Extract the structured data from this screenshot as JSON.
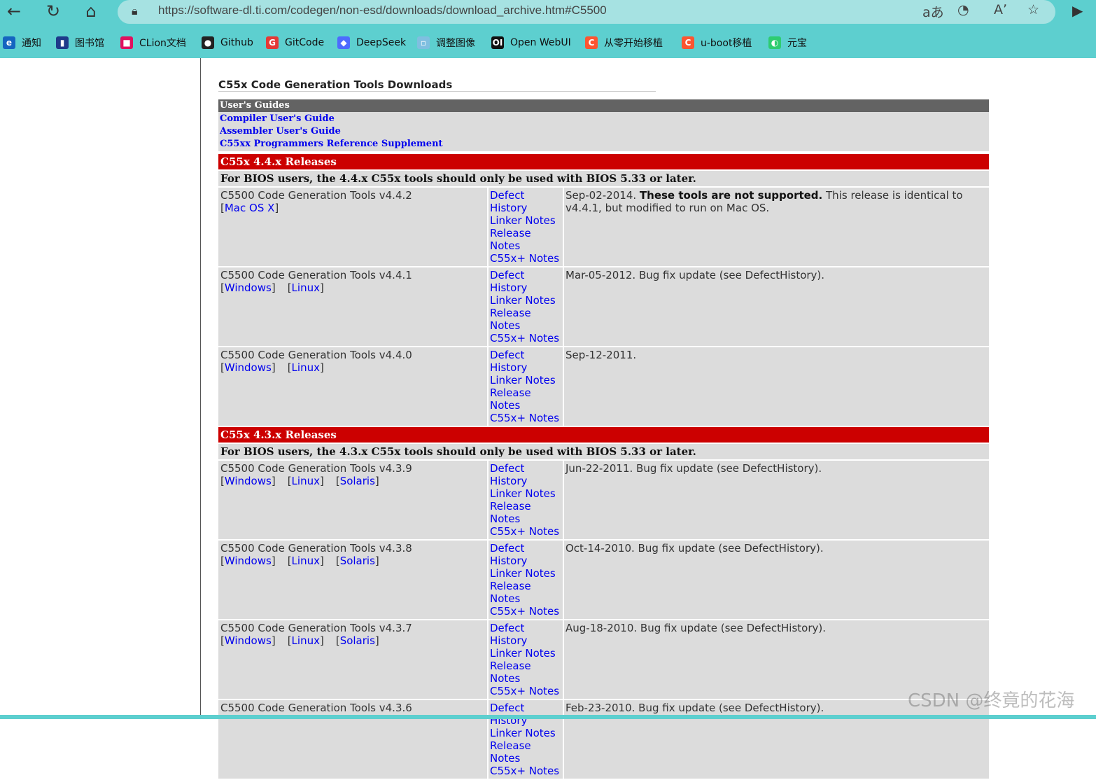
{
  "browser": {
    "url": "https://software-dl.ti.com/codegen/non-esd/downloads/download_archive.htm#C5500",
    "url_icons": {
      "translate": "aあ",
      "read_aloud": "Aʼ"
    },
    "bookmarks": [
      {
        "label": "通知",
        "color": "#1565c0",
        "icon": "e"
      },
      {
        "label": "图书馆",
        "color": "#1e3a8a",
        "icon": "▮"
      },
      {
        "label": "CLion文档",
        "color": "#e0115f",
        "icon": "■"
      },
      {
        "label": "Github",
        "color": "#222222",
        "icon": "●"
      },
      {
        "label": "GitCode",
        "color": "#e53935",
        "icon": "G"
      },
      {
        "label": "DeepSeek",
        "color": "#4d6bfe",
        "icon": "◆"
      },
      {
        "label": "调整图像",
        "color": "#7fbfe0",
        "icon": "▫"
      },
      {
        "label": "Open WebUI",
        "color": "#111111",
        "icon": "OI"
      },
      {
        "label": "从零开始移植",
        "color": "#fc5531",
        "icon": "C"
      },
      {
        "label": "u-boot移植",
        "color": "#fc5531",
        "icon": "C"
      },
      {
        "label": "元宝",
        "color": "#2ecc71",
        "icon": "◐"
      }
    ]
  },
  "page": {
    "title": "C55x Code Generation Tools Downloads",
    "users_guides": {
      "heading": "User's Guides",
      "links": [
        "Compiler User's Guide",
        "Assembler User's Guide",
        "C55xx Programmers Reference Supplement"
      ]
    },
    "sections": [
      {
        "heading": "C55x 4.4.x Releases",
        "note": "For BIOS users, the 4.4.x C55x tools should only be used with BIOS 5.33 or later.",
        "releases": [
          {
            "name": "C5500 Code Generation Tools v4.4.2",
            "platforms": [
              "Mac OS X"
            ],
            "desc_lead": "Sep-02-2014. ",
            "desc_bold": "These tools are not supported.",
            "desc_rest": " This release is identical to v4.4.1, but modified to run on Mac OS."
          },
          {
            "name": "C5500 Code Generation Tools v4.4.1",
            "platforms": [
              "Windows",
              "Linux"
            ],
            "desc_lead": "Mar-05-2012. Bug fix update (see DefectHistory).",
            "desc_bold": "",
            "desc_rest": ""
          },
          {
            "name": "C5500 Code Generation Tools v4.4.0",
            "platforms": [
              "Windows",
              "Linux"
            ],
            "desc_lead": "Sep-12-2011.",
            "desc_bold": "",
            "desc_rest": ""
          }
        ]
      },
      {
        "heading": "C55x 4.3.x Releases",
        "note": "For BIOS users, the 4.3.x C55x tools should only be used with BIOS 5.33 or later.",
        "releases": [
          {
            "name": "C5500 Code Generation Tools v4.3.9",
            "platforms": [
              "Windows",
              "Linux",
              "Solaris"
            ],
            "desc_lead": "Jun-22-2011. Bug fix update (see DefectHistory).",
            "desc_bold": "",
            "desc_rest": ""
          },
          {
            "name": "C5500 Code Generation Tools v4.3.8",
            "platforms": [
              "Windows",
              "Linux",
              "Solaris"
            ],
            "desc_lead": "Oct-14-2010. Bug fix update (see DefectHistory).",
            "desc_bold": "",
            "desc_rest": ""
          },
          {
            "name": "C5500 Code Generation Tools v4.3.7",
            "platforms": [
              "Windows",
              "Linux",
              "Solaris"
            ],
            "desc_lead": "Aug-18-2010. Bug fix update (see DefectHistory).",
            "desc_bold": "",
            "desc_rest": ""
          },
          {
            "name": "C5500 Code Generation Tools v4.3.6",
            "platforms": [],
            "desc_lead": "Feb-23-2010. Bug fix update (see DefectHistory).",
            "desc_bold": "",
            "desc_rest": ""
          }
        ]
      }
    ],
    "doc_links": [
      "Defect",
      "History",
      "Linker Notes",
      "Release",
      "Notes",
      "C55x+ Notes"
    ]
  },
  "watermark": "CSDN @终竟的花海"
}
